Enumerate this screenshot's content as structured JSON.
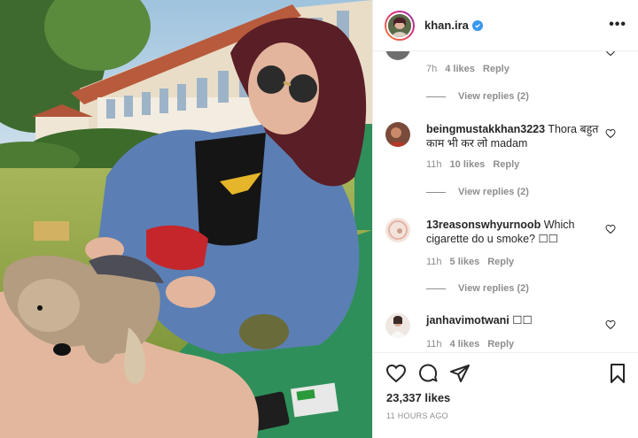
{
  "post": {
    "username": "khan.ira",
    "verified": true,
    "more_label": "•••",
    "likes": "23,337 likes",
    "posted": "11 HOURS AGO"
  },
  "comments": [
    {
      "username": "",
      "text": "",
      "time": "7h",
      "likes": "4 likes",
      "reply": "Reply",
      "view_replies": "View replies (2)"
    },
    {
      "username": "beingmustakkhan3223",
      "text": "Thora बहुत काम भी कर लो madam",
      "time": "11h",
      "likes": "10 likes",
      "reply": "Reply",
      "view_replies": "View replies (2)"
    },
    {
      "username": "13reasonswhyurnoob",
      "text": "Which cigarette do u smoke? ☐☐",
      "time": "11h",
      "likes": "5 likes",
      "reply": "Reply",
      "view_replies": "View replies (2)"
    },
    {
      "username": "janhavimotwani",
      "text": "☐☐",
      "time": "11h",
      "likes": "4 likes",
      "reply": "Reply"
    }
  ],
  "icons": {
    "like": "heart-icon",
    "comment": "comment-bubble-icon",
    "share": "paper-plane-icon",
    "save": "bookmark-icon"
  },
  "colors": {
    "verified_blue": "#3897f0",
    "meta_gray": "#8e8e8e",
    "text": "#262626"
  }
}
